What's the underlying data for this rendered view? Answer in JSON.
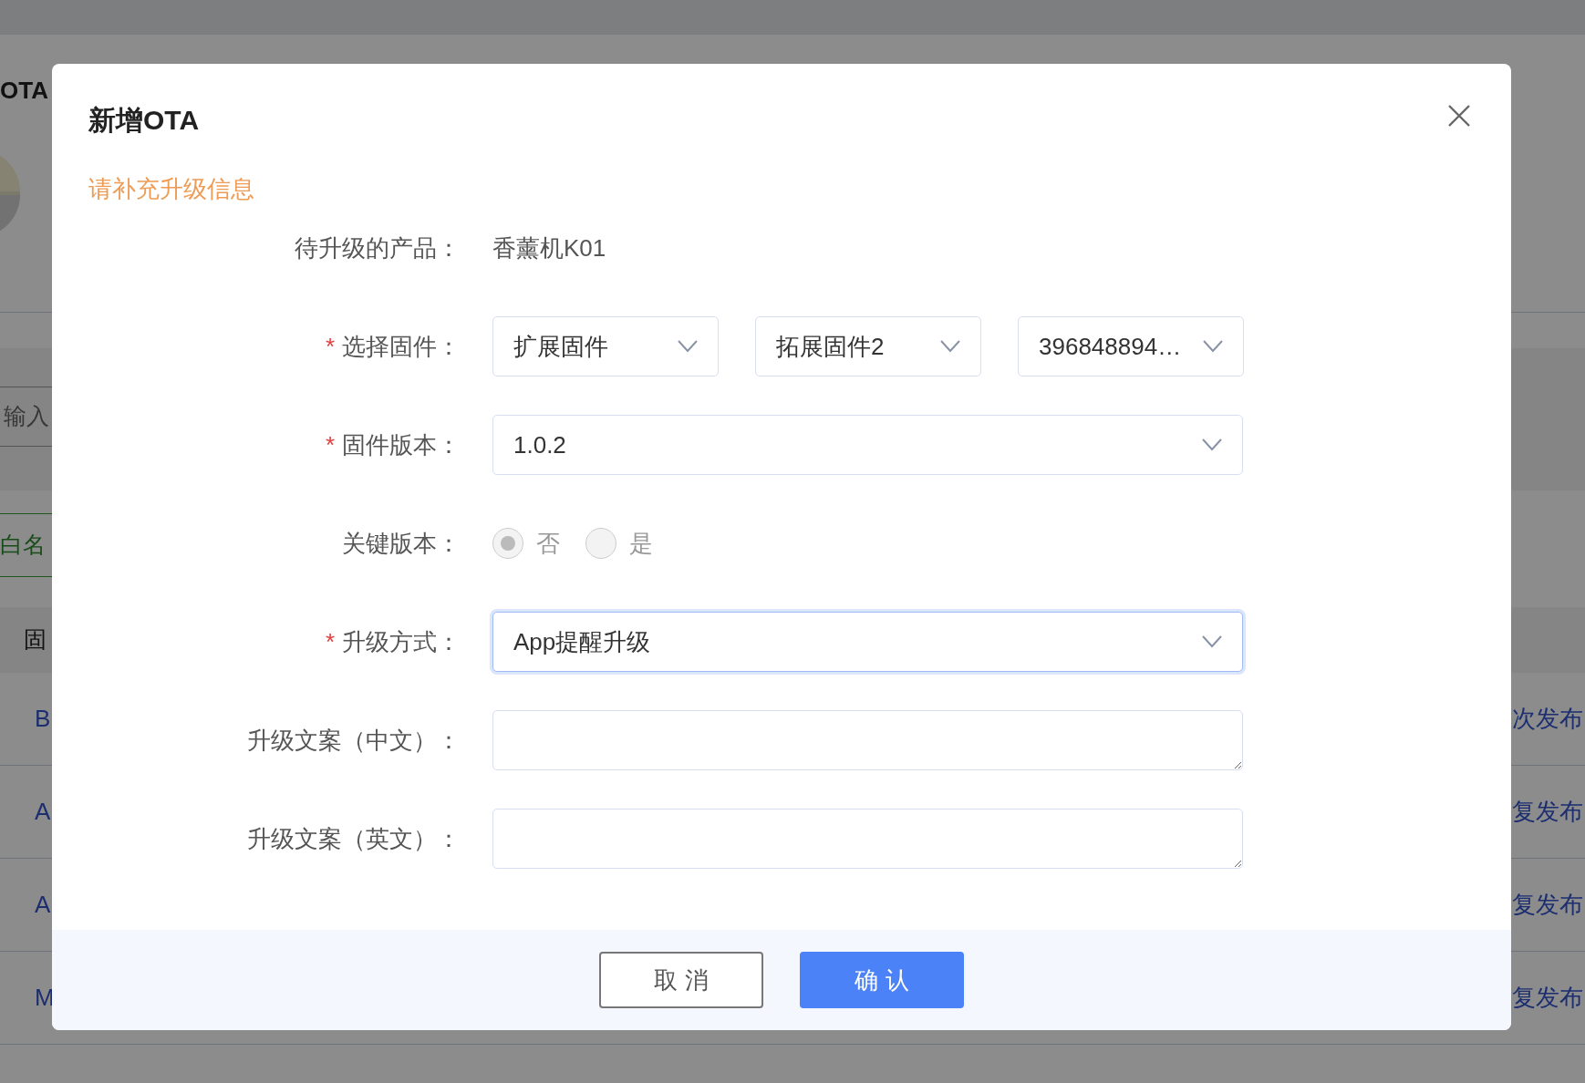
{
  "background": {
    "page_title": "OTA",
    "search_placeholder": "输入",
    "whitelist_button": "白名",
    "table_header": "固",
    "rows": [
      {
        "name": "B",
        "action": "次发布"
      },
      {
        "name": "A",
        "action": "复发布"
      },
      {
        "name": "A",
        "action": "复发布"
      },
      {
        "name": "M",
        "action": "复发布"
      }
    ]
  },
  "dialog": {
    "title": "新增OTA",
    "subtitle": "请补充升级信息",
    "required_mark": "*",
    "fields": [
      {
        "kind": "text",
        "label": "待升级的产品：",
        "required": false,
        "value": "香薰机K01"
      },
      {
        "kind": "selects",
        "label": "选择固件：",
        "required": true,
        "values": [
          "扩展固件",
          "拓展固件2",
          "396848894…"
        ]
      },
      {
        "kind": "select",
        "label": "固件版本：",
        "required": true,
        "value": "1.0.2",
        "focused": false
      },
      {
        "kind": "radio",
        "label": "关键版本：",
        "required": false,
        "disabled": true,
        "options": [
          {
            "label": "否",
            "selected": true
          },
          {
            "label": "是",
            "selected": false
          }
        ]
      },
      {
        "kind": "select",
        "label": "升级方式：",
        "required": true,
        "value": "App提醒升级",
        "focused": true
      },
      {
        "kind": "textarea",
        "label": "升级文案（中文）：",
        "required": false
      },
      {
        "kind": "textarea",
        "label": "升级文案（英文）：",
        "required": false
      }
    ],
    "buttons": [
      {
        "kind": "cancel",
        "label": "取 消"
      },
      {
        "kind": "primary",
        "label": "确 认"
      }
    ]
  }
}
